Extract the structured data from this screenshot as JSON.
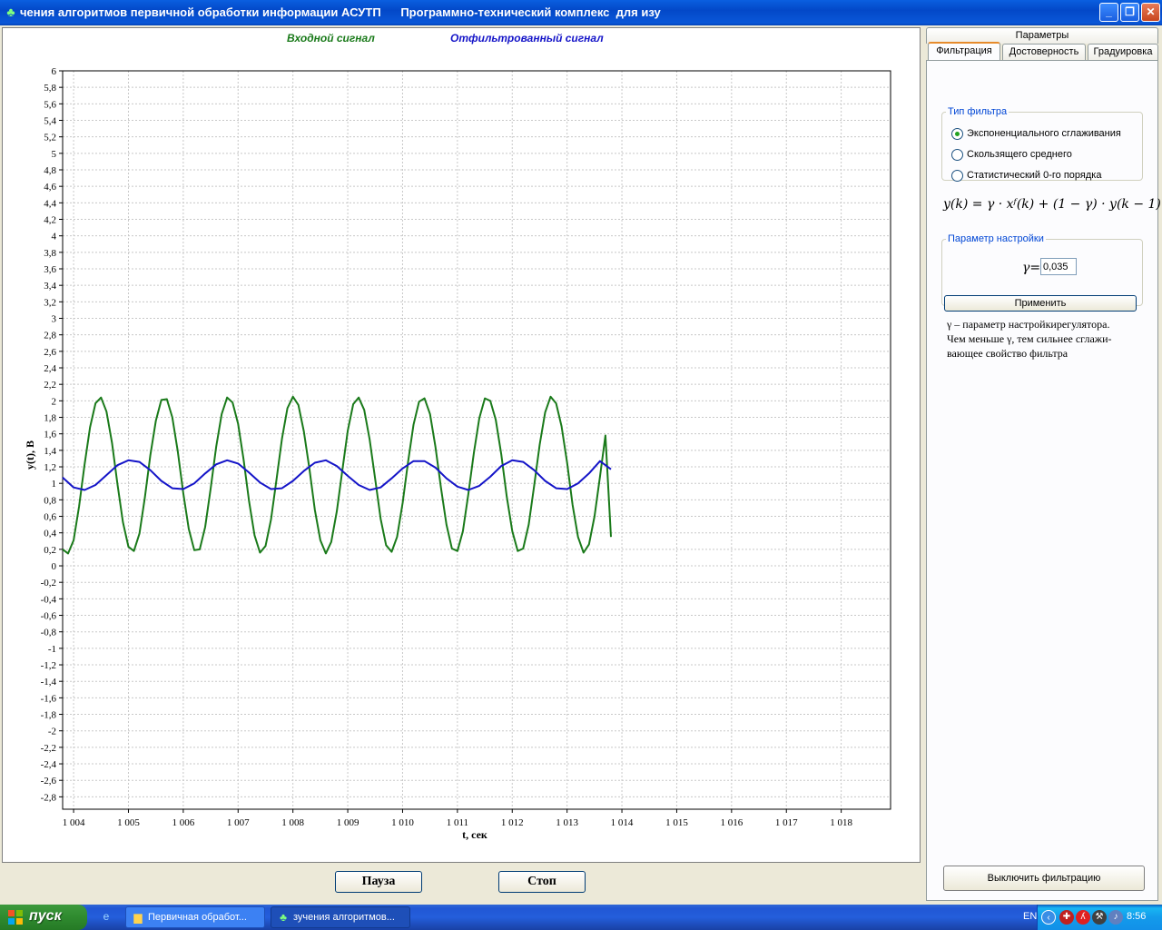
{
  "window": {
    "title": "чения алгоритмов первичной обработки информации АСУТП      Программно-технический комплекс  для изу",
    "controls": {
      "minimize": "_",
      "restore": "❐",
      "close": "✕"
    }
  },
  "chart_data": {
    "type": "line",
    "legend": [
      "Входной сигнал",
      "Отфильтрованный сигнал"
    ],
    "xlabel": "t, сек",
    "ylabel": "y(t), B",
    "xlim": [
      1003.8,
      1018.9
    ],
    "ylim": [
      -2.95,
      6
    ],
    "grid": true,
    "x_ticks": [
      "1 004",
      "1 005",
      "1 006",
      "1 007",
      "1 008",
      "1 009",
      "1 010",
      "1 011",
      "1 012",
      "1 013",
      "1 014",
      "1 015",
      "1 016",
      "1 017",
      "1 018"
    ],
    "y_ticks": [
      "6",
      "5,8",
      "5,6",
      "5,4",
      "5,2",
      "5",
      "4,8",
      "4,6",
      "4,4",
      "4,2",
      "4",
      "3,8",
      "3,6",
      "3,4",
      "3,2",
      "3",
      "2,8",
      "2,6",
      "2,4",
      "2,2",
      "2",
      "1,8",
      "1,6",
      "1,4",
      "1,2",
      "1",
      "0,8",
      "0,6",
      "0,4",
      "0,2",
      "0",
      "-0,2",
      "-0,4",
      "-0,6",
      "-0,8",
      "-1",
      "-1,2",
      "-1,4",
      "-1,6",
      "-1,8",
      "-2",
      "-2,2",
      "-2,4",
      "-2,6",
      "-2,8"
    ],
    "series": [
      {
        "name": "Входной сигнал",
        "color": "#1a7a1a",
        "x": [
          1003.8,
          1003.9,
          1004.0,
          1004.1,
          1004.2,
          1004.3,
          1004.4,
          1004.5,
          1004.6,
          1004.7,
          1004.8,
          1004.9,
          1005.0,
          1005.1,
          1005.2,
          1005.3,
          1005.4,
          1005.5,
          1005.6,
          1005.7,
          1005.8,
          1005.9,
          1006.0,
          1006.1,
          1006.2,
          1006.3,
          1006.4,
          1006.5,
          1006.6,
          1006.7,
          1006.8,
          1006.9,
          1007.0,
          1007.1,
          1007.2,
          1007.3,
          1007.4,
          1007.5,
          1007.6,
          1007.7,
          1007.8,
          1007.9,
          1008.0,
          1008.1,
          1008.2,
          1008.3,
          1008.4,
          1008.5,
          1008.6,
          1008.7,
          1008.8,
          1008.9,
          1009.0,
          1009.1,
          1009.2,
          1009.3,
          1009.4,
          1009.5,
          1009.6,
          1009.7,
          1009.8,
          1009.9,
          1010.0,
          1010.1,
          1010.2,
          1010.3,
          1010.4,
          1010.5,
          1010.6,
          1010.7,
          1010.8,
          1010.9,
          1011.0,
          1011.1,
          1011.2,
          1011.3,
          1011.4,
          1011.5,
          1011.6,
          1011.7,
          1011.8,
          1011.9,
          1012.0,
          1012.1,
          1012.2,
          1012.3,
          1012.4,
          1012.5,
          1012.6,
          1012.7,
          1012.8,
          1012.9,
          1013.0,
          1013.1,
          1013.2,
          1013.3,
          1013.4,
          1013.5,
          1013.6,
          1013.7,
          1013.8
        ],
        "y": [
          0.2,
          0.15,
          0.31,
          0.72,
          1.23,
          1.68,
          1.97,
          2.04,
          1.87,
          1.49,
          0.99,
          0.53,
          0.23,
          0.18,
          0.39,
          0.83,
          1.34,
          1.76,
          2.01,
          2.02,
          1.8,
          1.39,
          0.88,
          0.45,
          0.19,
          0.2,
          0.47,
          0.94,
          1.44,
          1.84,
          2.04,
          1.98,
          1.72,
          1.29,
          0.78,
          0.37,
          0.16,
          0.24,
          0.56,
          1.04,
          1.54,
          1.91,
          2.05,
          1.95,
          1.63,
          1.18,
          0.68,
          0.31,
          0.15,
          0.29,
          0.66,
          1.15,
          1.64,
          1.96,
          2.04,
          1.89,
          1.53,
          1.05,
          0.57,
          0.25,
          0.17,
          0.35,
          0.76,
          1.26,
          1.71,
          1.99,
          2.03,
          1.84,
          1.44,
          0.95,
          0.5,
          0.21,
          0.18,
          0.42,
          0.87,
          1.37,
          1.79,
          2.03,
          2.0,
          1.77,
          1.35,
          0.84,
          0.42,
          0.18,
          0.21,
          0.5,
          0.97,
          1.47,
          1.86,
          2.05,
          1.97,
          1.69,
          1.25,
          0.74,
          0.35,
          0.16,
          0.26,
          0.6,
          1.08,
          1.58,
          0.35
        ]
      },
      {
        "name": "Отфильтрованный сигнал",
        "color": "#1414c8",
        "x": [
          1003.8,
          1004.0,
          1004.2,
          1004.4,
          1004.6,
          1004.8,
          1005.0,
          1005.2,
          1005.4,
          1005.6,
          1005.8,
          1006.0,
          1006.2,
          1006.4,
          1006.6,
          1006.8,
          1007.0,
          1007.2,
          1007.4,
          1007.6,
          1007.8,
          1008.0,
          1008.2,
          1008.4,
          1008.6,
          1008.8,
          1009.0,
          1009.2,
          1009.4,
          1009.6,
          1009.8,
          1010.0,
          1010.2,
          1010.4,
          1010.6,
          1010.8,
          1011.0,
          1011.2,
          1011.4,
          1011.6,
          1011.8,
          1012.0,
          1012.2,
          1012.4,
          1012.6,
          1012.8,
          1013.0,
          1013.2,
          1013.4,
          1013.6,
          1013.8
        ],
        "y": [
          1.07,
          0.95,
          0.92,
          0.98,
          1.1,
          1.22,
          1.28,
          1.26,
          1.16,
          1.03,
          0.94,
          0.93,
          1.0,
          1.12,
          1.23,
          1.28,
          1.24,
          1.13,
          1.01,
          0.93,
          0.94,
          1.03,
          1.15,
          1.25,
          1.28,
          1.21,
          1.09,
          0.98,
          0.92,
          0.95,
          1.06,
          1.18,
          1.27,
          1.27,
          1.19,
          1.06,
          0.96,
          0.92,
          0.97,
          1.08,
          1.21,
          1.28,
          1.26,
          1.16,
          1.03,
          0.94,
          0.93,
          1.0,
          1.12,
          1.27,
          1.17
        ]
      }
    ]
  },
  "bottom": {
    "pause_label": "Пауза",
    "stop_label": "Стоп"
  },
  "right_panel": {
    "tabs_row1": [
      "Параметры"
    ],
    "tabs_row2": [
      "Фильтрация",
      "Достоверность",
      "Градуировка"
    ],
    "filter_type": {
      "legend": "Тип фильтра",
      "options": [
        "Экспоненциального сглаживания",
        "Скользящего среднего",
        "Статистический 0-го порядка"
      ],
      "selected": 0
    },
    "formula": "y(k) = γ · xᶠ(k) + (1 − γ) · y(k − 1)",
    "param": {
      "legend": "Параметр настройки",
      "gamma_label": "γ=",
      "gamma_value": "0,035"
    },
    "apply_label": "Применить",
    "help_lines": [
      "γ – параметр настройкирегулятора.",
      "Чем меньше γ, тем сильнее сглажи-",
      "вающее свойство фильтра"
    ],
    "disable_label": "Выключить фильтрацию"
  },
  "taskbar": {
    "start_label": "пуск",
    "tasks": [
      "Первичная обработ...",
      "зучения алгоритмов..."
    ],
    "lang": "EN",
    "clock": "8:56"
  }
}
